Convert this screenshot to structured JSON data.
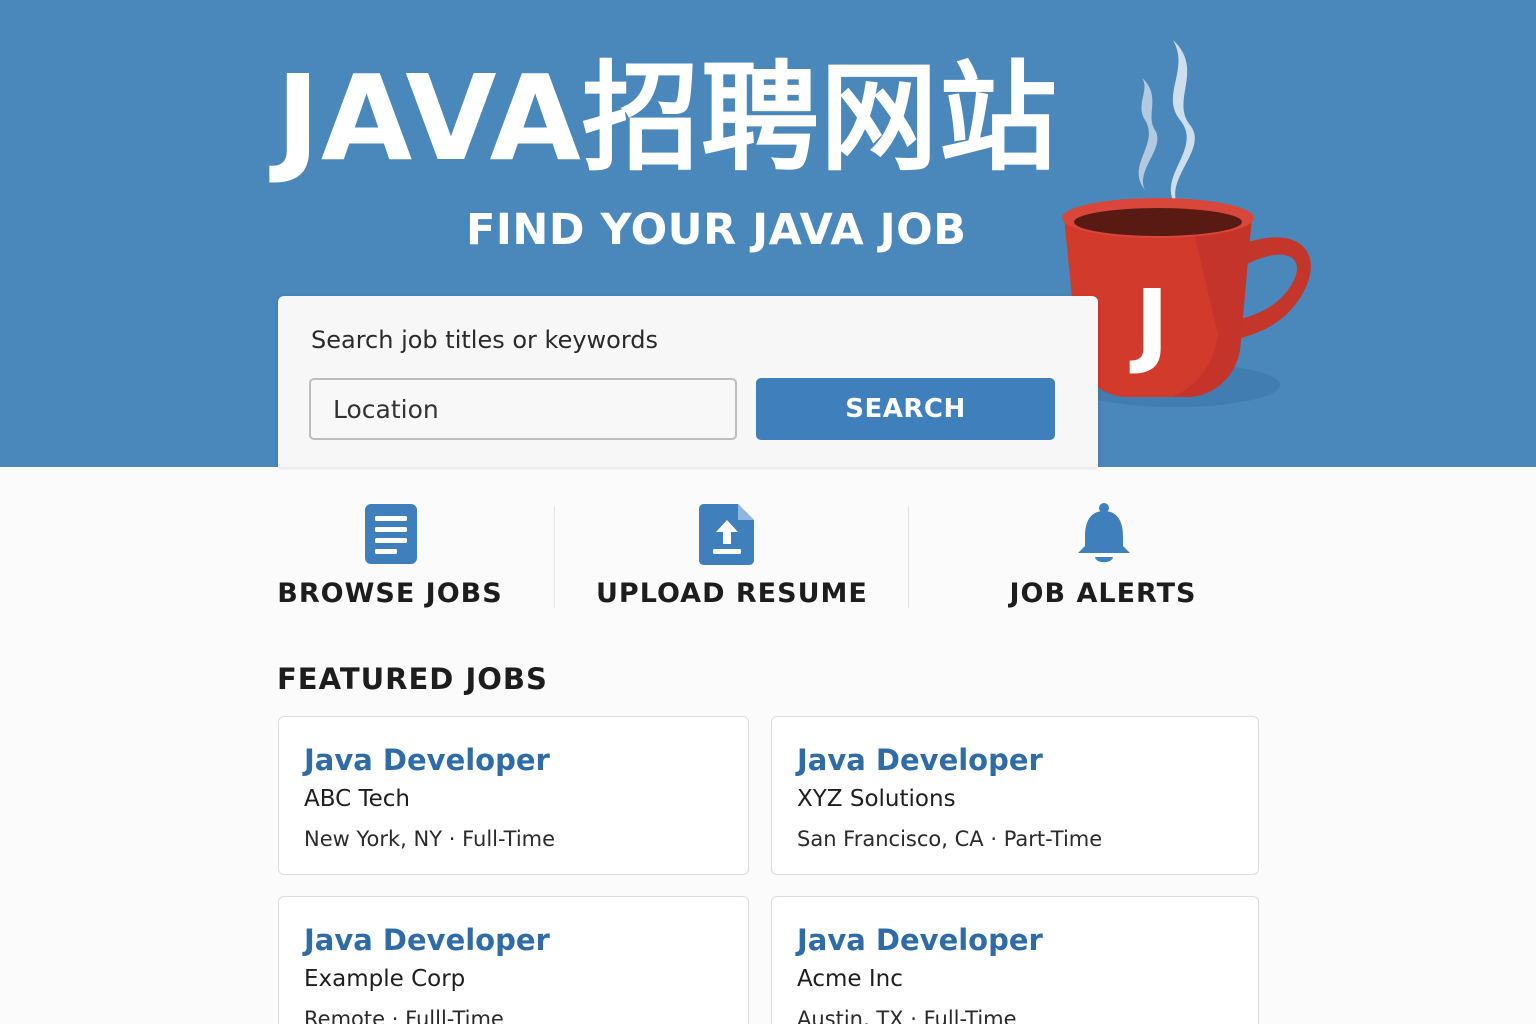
{
  "hero": {
    "title": "JAVA招聘网站",
    "subtitle": "FIND YOUR JAVA JOB",
    "mug_letter": "J"
  },
  "search": {
    "keywords_placeholder": "Search job titles or keywords",
    "location_placeholder": "Location",
    "button_label": "SEARCH"
  },
  "quick_links": {
    "browse": {
      "label": "BROWSE JOBS",
      "icon": "document-list-icon"
    },
    "upload": {
      "label": "UPLOAD RESUME",
      "icon": "file-upload-icon"
    },
    "alerts": {
      "label": "JOB ALERTS",
      "icon": "bell-icon"
    }
  },
  "featured": {
    "heading": "FEATURED JOBS",
    "jobs": [
      {
        "title": "Java Developer",
        "company": "ABC Tech",
        "location": "New York, NY",
        "type": "Full-Time"
      },
      {
        "title": "Java Developer",
        "company": "XYZ Solutions",
        "location": "San Francisco, CA",
        "type": "Part-Time"
      },
      {
        "title": "Java Developer",
        "company": "Example Corp",
        "location": "Remote",
        "type": "Fulll-Time"
      },
      {
        "title": "Java Developer",
        "company": "Acme Inc",
        "location": "Austin, TX",
        "type": "Full-Time"
      }
    ]
  },
  "colors": {
    "hero_bg": "#4a87bb",
    "accent": "#3f7fbb",
    "job_title": "#2f6ca5",
    "mug_red": "#d23a2c"
  }
}
